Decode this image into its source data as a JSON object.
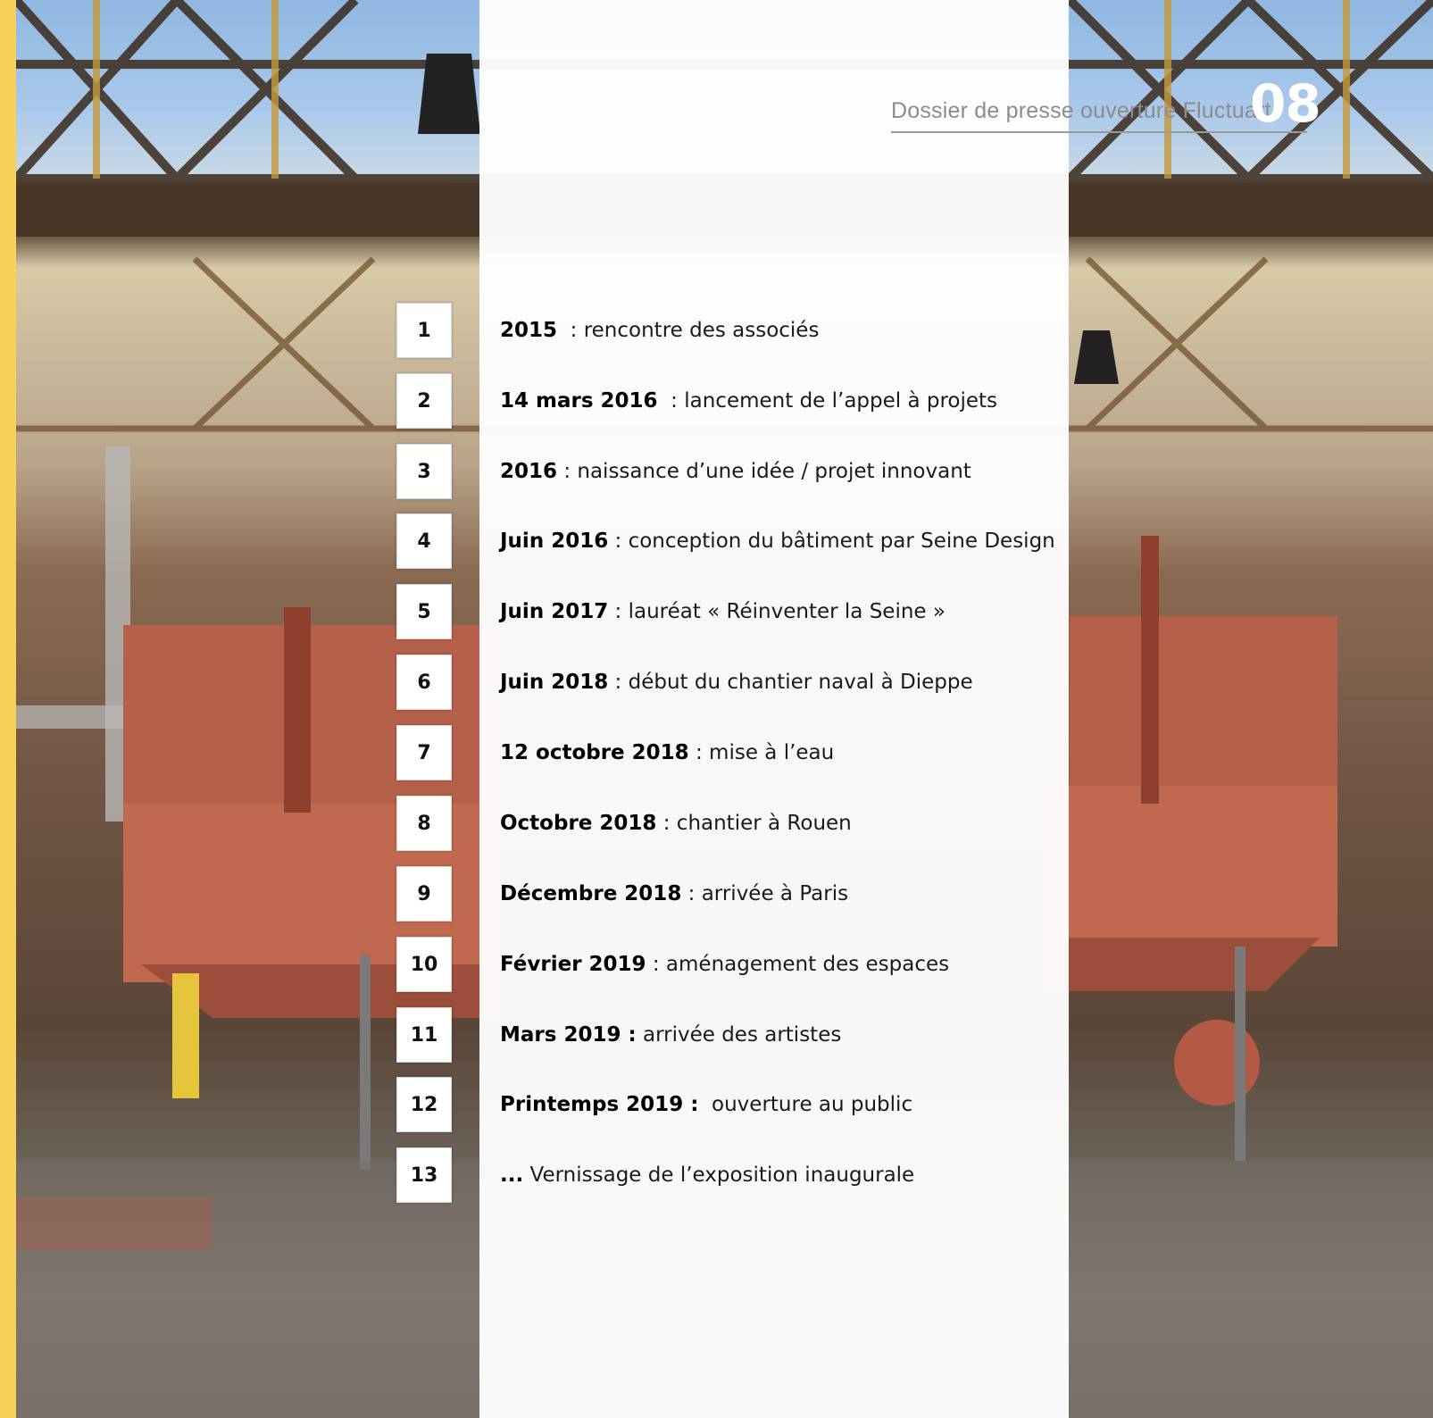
{
  "header": {
    "title": "Dossier de presse ouverture Fluctuart",
    "page_number": "08"
  },
  "timeline": [
    {
      "num": "1",
      "date": "2015",
      "text": "  : rencontre des associés"
    },
    {
      "num": "2",
      "date": "14 mars 2016",
      "text": "  : lancement de l’appel à projets"
    },
    {
      "num": "3",
      "date": "2016",
      "text": " : naissance d’une idée / projet innovant"
    },
    {
      "num": "4",
      "date": "Juin 2016",
      "text": " : conception du bâtiment par Seine Design"
    },
    {
      "num": "5",
      "date": "Juin 2017",
      "text": " : lauréat « Réinventer la Seine »"
    },
    {
      "num": "6",
      "date": "Juin 2018",
      "text": " : début du chantier naval à Dieppe"
    },
    {
      "num": "7",
      "date": "12 octobre 2018",
      "text": " : mise à l’eau"
    },
    {
      "num": "8",
      "date": "Octobre 2018",
      "text": " : chantier à Rouen"
    },
    {
      "num": "9",
      "date": "Décembre 2018",
      "text": " : arrivée à Paris"
    },
    {
      "num": "10",
      "date": "Février 2019",
      "text": " : aménagement des espaces"
    },
    {
      "num": "11",
      "date": "Mars 2019 :",
      "text": " arrivée des artistes"
    },
    {
      "num": "12",
      "date": "Printemps 2019 :",
      "text": "  ouverture au public"
    },
    {
      "num": "13",
      "date": "...",
      "text": " Vernissage de l’exposition inaugurale"
    }
  ],
  "colors": {
    "accent": "#f5d35a",
    "panel": "#ffffff",
    "header_text": "#8c8c8c"
  }
}
